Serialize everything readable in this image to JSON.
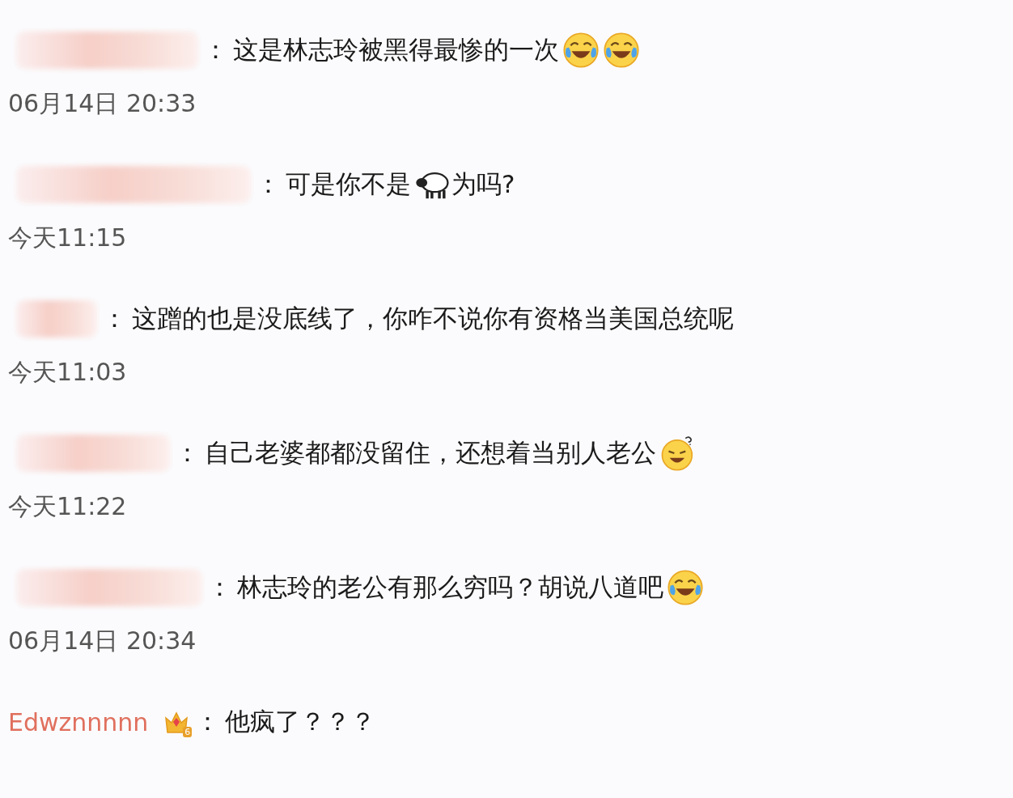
{
  "comments": [
    {
      "author": {
        "kind": "redacted"
      },
      "separator": "：",
      "content": [
        {
          "kind": "text",
          "text": "这是林志玲被黑得最惨的一次"
        },
        {
          "kind": "laugh_cry"
        },
        {
          "kind": "laugh_cry"
        }
      ],
      "time": "06月14日 20:33"
    },
    {
      "author": {
        "kind": "redacted"
      },
      "separator": "：",
      "content": [
        {
          "kind": "text",
          "text": "可是你不是"
        },
        {
          "kind": "sheep"
        },
        {
          "kind": "text",
          "text": "为吗?"
        }
      ],
      "time": "今天11:15"
    },
    {
      "author": {
        "kind": "redacted"
      },
      "separator": "：",
      "content": [
        {
          "kind": "text",
          "text": "这蹭的也是没底线了，你咋不说你有资格当美国总统呢"
        }
      ],
      "time": "今天11:03"
    },
    {
      "author": {
        "kind": "redacted"
      },
      "separator": "：",
      "content": [
        {
          "kind": "text",
          "text": "自己老婆都都没留住，还想着当别人老公"
        },
        {
          "kind": "grin"
        }
      ],
      "time": "今天11:22"
    },
    {
      "author": {
        "kind": "redacted"
      },
      "separator": "：",
      "content": [
        {
          "kind": "text",
          "text": "林志玲的老公有那么穷吗？胡说八道吧"
        },
        {
          "kind": "laugh_cry"
        }
      ],
      "time": "06月14日 20:34"
    },
    {
      "author": {
        "kind": "named",
        "name": "Edwznnnnn",
        "badge": "6"
      },
      "separator": "：",
      "content": [
        {
          "kind": "text",
          "text": "他疯了？？？"
        }
      ]
    }
  ]
}
